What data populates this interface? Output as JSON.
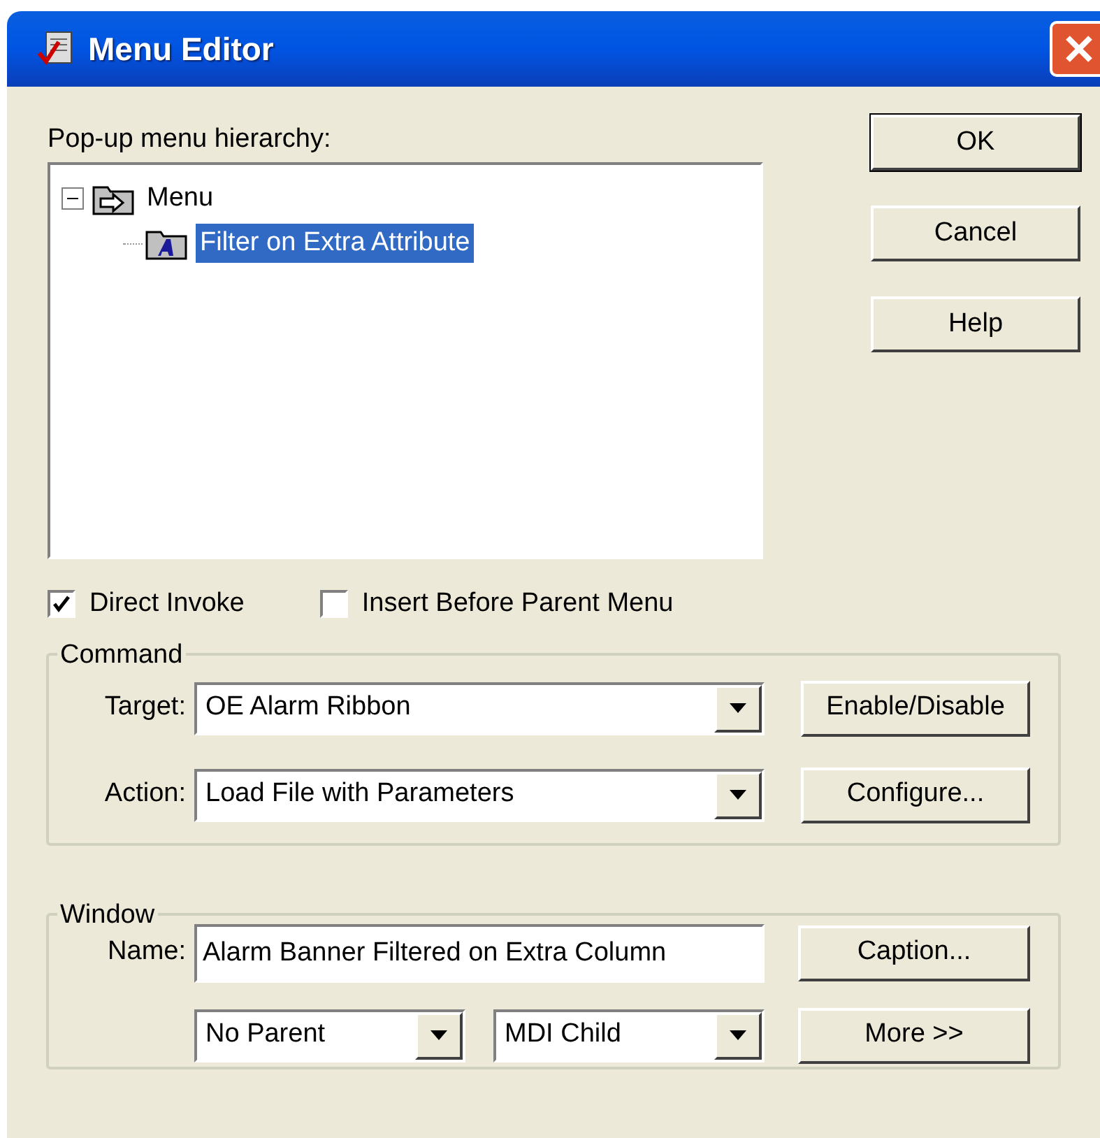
{
  "window": {
    "title": "Menu Editor"
  },
  "hierarchy": {
    "label": "Pop-up menu hierarchy:",
    "tree": [
      {
        "label": "Menu",
        "kind": "arrow",
        "expanded": true,
        "selected": false,
        "children": [
          {
            "label": "Filter on Extra Attribute",
            "kind": "attribute",
            "selected": true
          }
        ]
      }
    ]
  },
  "buttons": [
    {
      "label": "OK",
      "default": true
    },
    {
      "label": "Cancel",
      "default": false
    },
    {
      "label": "Help",
      "default": false
    }
  ],
  "options": [
    {
      "label": "Direct Invoke",
      "checked": true
    },
    {
      "label": "Insert Before Parent Menu",
      "checked": false
    }
  ],
  "command": {
    "title": "Command",
    "rows": [
      {
        "label": "Target:",
        "value": "OE Alarm Ribbon",
        "button": "Enable/Disable"
      },
      {
        "label": "Action:",
        "value": "Load File with Parameters",
        "button": "Configure..."
      }
    ]
  },
  "window_group": {
    "title": "Window",
    "name_label": "Name:",
    "name_value": "Alarm Banner Filtered on Extra Column",
    "caption_button": "Caption...",
    "parent": "No Parent",
    "type": "MDI Child",
    "more_button": "More >>"
  }
}
